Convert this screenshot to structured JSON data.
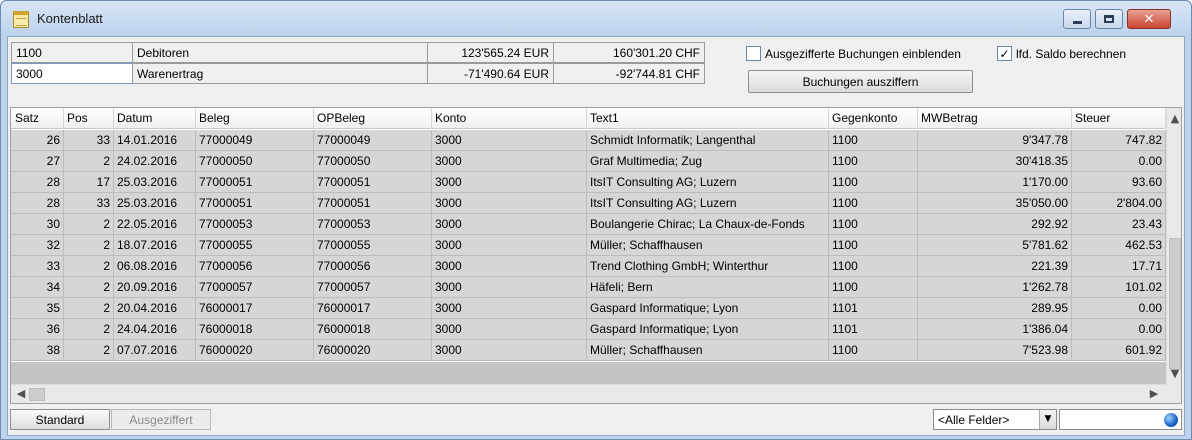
{
  "window": {
    "title": "Kontenblatt",
    "close_glyph": "✕"
  },
  "accounts": [
    {
      "number": "1100",
      "name": "Debitoren",
      "amount_eur": "123'565.24 EUR",
      "amount_chf": "160'301.20 CHF"
    },
    {
      "number": "3000",
      "name": "Warenertrag",
      "amount_eur": "-71'490.64 EUR",
      "amount_chf": "-92'744.81 CHF"
    }
  ],
  "options": {
    "show_cleared_label": "Ausgezifferte Buchungen einblenden",
    "show_cleared_checked": false,
    "running_balance_label": "lfd. Saldo berechnen",
    "running_balance_checked": true,
    "check_glyph": "✓",
    "clear_button_label": "Buchungen ausziffern"
  },
  "grid": {
    "columns": [
      "Satz",
      "Pos",
      "Datum",
      "Beleg",
      "OPBeleg",
      "Konto",
      "Text1",
      "Gegenkonto",
      "MWBetrag",
      "Steuer"
    ],
    "rows": [
      [
        "26",
        "33",
        "14.01.2016",
        "77000049",
        "77000049",
        "3000",
        "Schmidt Informatik; Langenthal",
        "1100",
        "9'347.78",
        "747.82"
      ],
      [
        "27",
        "2",
        "24.02.2016",
        "77000050",
        "77000050",
        "3000",
        "Graf Multimedia; Zug",
        "1100",
        "30'418.35",
        "0.00"
      ],
      [
        "28",
        "17",
        "25.03.2016",
        "77000051",
        "77000051",
        "3000",
        "ItsIT Consulting AG; Luzern",
        "1100",
        "1'170.00",
        "93.60"
      ],
      [
        "28",
        "33",
        "25.03.2016",
        "77000051",
        "77000051",
        "3000",
        "ItsIT Consulting AG; Luzern",
        "1100",
        "35'050.00",
        "2'804.00"
      ],
      [
        "30",
        "2",
        "22.05.2016",
        "77000053",
        "77000053",
        "3000",
        "Boulangerie Chirac; La Chaux-de-Fonds",
        "1100",
        "292.92",
        "23.43"
      ],
      [
        "32",
        "2",
        "18.07.2016",
        "77000055",
        "77000055",
        "3000",
        "Müller; Schaffhausen",
        "1100",
        "5'781.62",
        "462.53"
      ],
      [
        "33",
        "2",
        "06.08.2016",
        "77000056",
        "77000056",
        "3000",
        "Trend Clothing GmbH; Winterthur",
        "1100",
        "221.39",
        "17.71"
      ],
      [
        "34",
        "2",
        "20.09.2016",
        "77000057",
        "77000057",
        "3000",
        "Häfeli; Bern",
        "1100",
        "1'262.78",
        "101.02"
      ],
      [
        "35",
        "2",
        "20.04.2016",
        "76000017",
        "76000017",
        "3000",
        "Gaspard Informatique; Lyon",
        "1101",
        "289.95",
        "0.00"
      ],
      [
        "36",
        "2",
        "24.04.2016",
        "76000018",
        "76000018",
        "3000",
        "Gaspard Informatique; Lyon",
        "1101",
        "1'386.04",
        "0.00"
      ],
      [
        "38",
        "2",
        "07.07.2016",
        "76000020",
        "76000020",
        "3000",
        "Müller; Schaffhausen",
        "1100",
        "7'523.98",
        "601.92"
      ]
    ],
    "scroll_up": "▲",
    "scroll_down": "▼",
    "scroll_left": "◀",
    "scroll_right": "▶"
  },
  "footer": {
    "tab_standard": "Standard",
    "tab_cleared": "Ausgeziffert",
    "field_select_value": "<Alle Felder>",
    "dropdown_glyph": "▼"
  },
  "icons": [
    "spreadsheet-icon",
    "minimize-icon",
    "maximize-icon",
    "close-icon",
    "check-icon",
    "chevron-down-icon",
    "globe-icon"
  ]
}
